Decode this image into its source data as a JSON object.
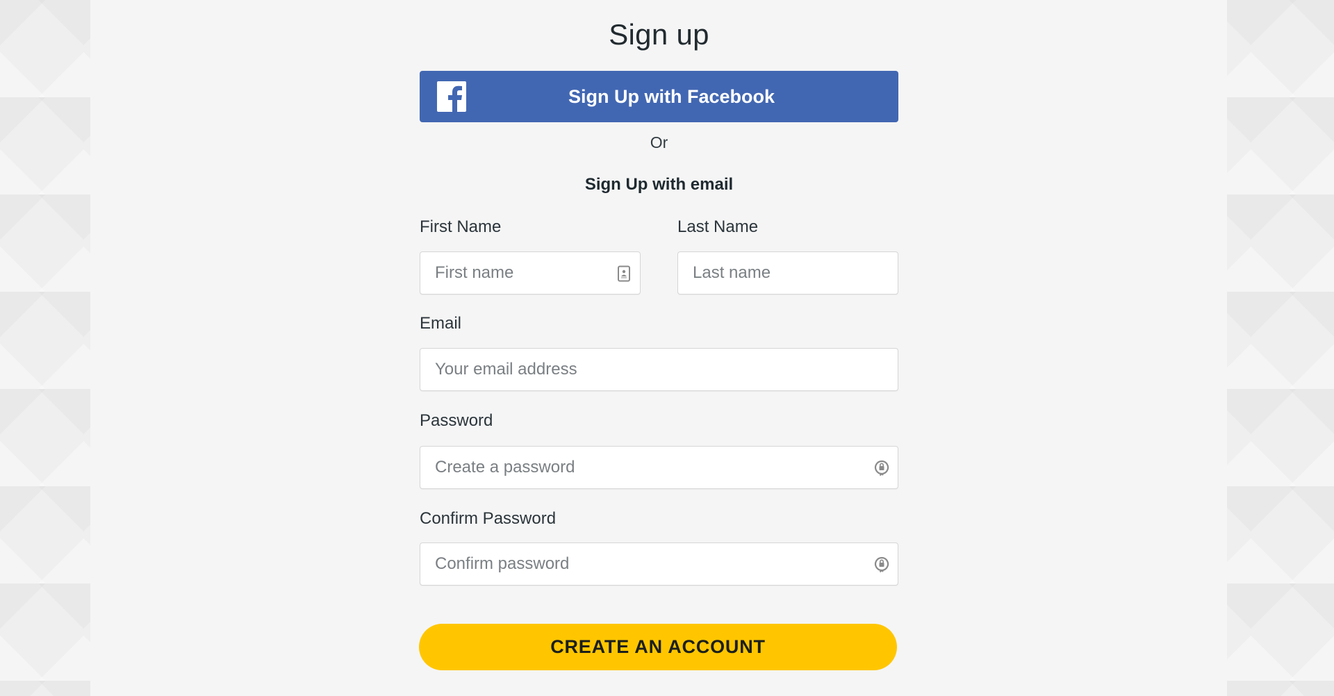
{
  "page": {
    "title": "Sign up"
  },
  "facebook": {
    "button_label": "Sign Up with Facebook",
    "icon": "facebook-icon",
    "color": "#4267b2"
  },
  "divider_text": "Or",
  "email_section_heading": "Sign Up with email",
  "fields": {
    "first_name": {
      "label": "First Name",
      "placeholder": "First name",
      "value": "",
      "icon": "contact-card-icon"
    },
    "last_name": {
      "label": "Last Name",
      "placeholder": "Last name",
      "value": ""
    },
    "email": {
      "label": "Email",
      "placeholder": "Your email address",
      "value": ""
    },
    "password": {
      "label": "Password",
      "placeholder": "Create a password",
      "value": "",
      "icon": "password-key-icon"
    },
    "confirm_password": {
      "label": "Confirm Password",
      "placeholder": "Confirm password",
      "value": "",
      "icon": "password-key-icon"
    }
  },
  "submit": {
    "label": "CREATE AN ACCOUNT",
    "color": "#ffc600"
  }
}
